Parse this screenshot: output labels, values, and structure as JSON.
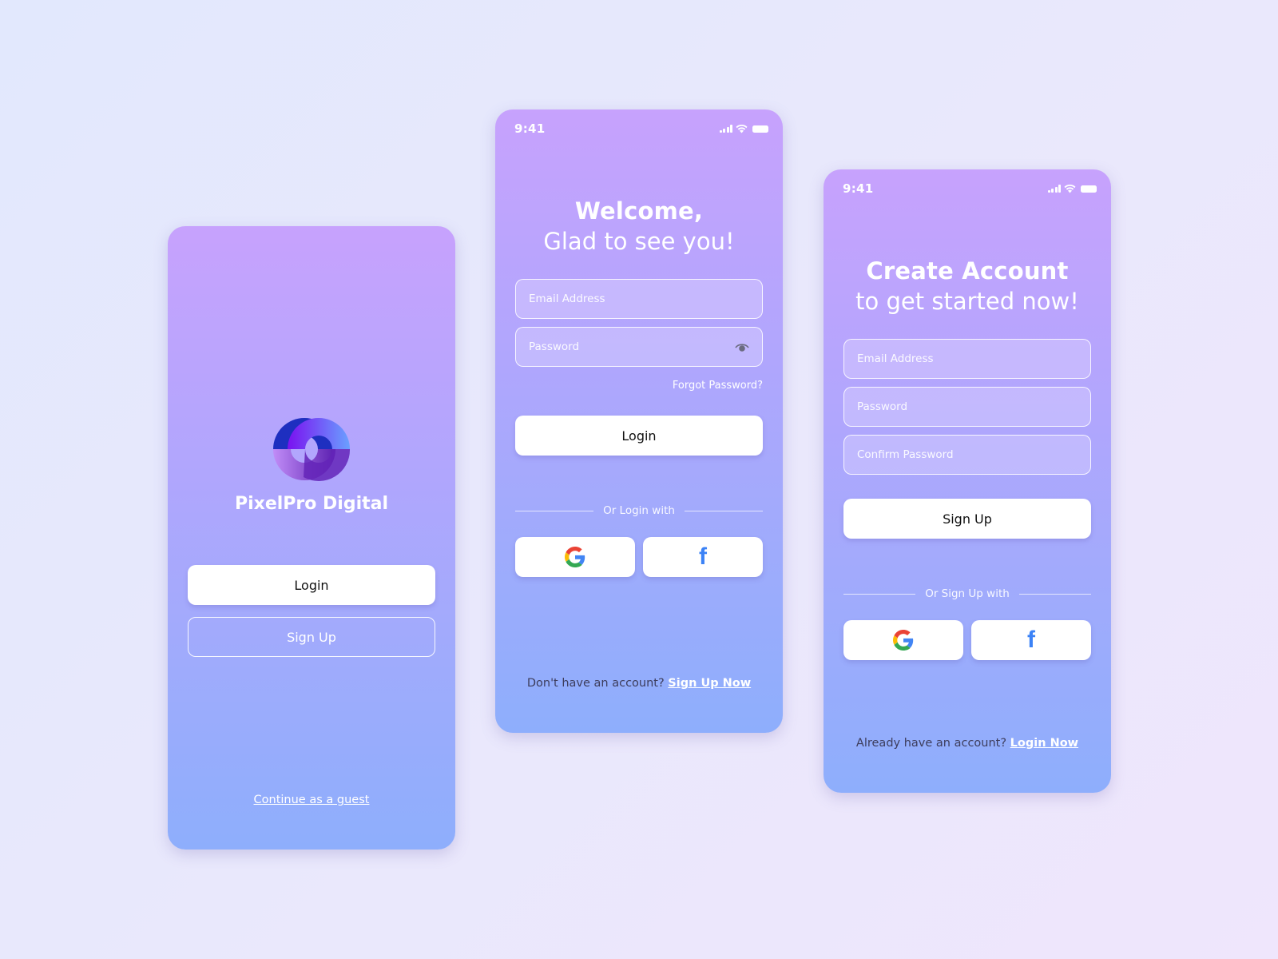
{
  "splash": {
    "brand_name": "PixelPro Digital",
    "login_label": "Login",
    "signup_label": "Sign Up",
    "guest_label": "Continue as a guest"
  },
  "login": {
    "status_time": "9:41",
    "title_bold": "Welcome,",
    "title_light": "Glad to see you!",
    "email_placeholder": "Email Address",
    "password_placeholder": "Password",
    "forgot_label": "Forgot Password?",
    "login_label": "Login",
    "divider_label": "Or Login with",
    "footer_prompt": "Don't have an account?",
    "footer_link": "Sign Up Now",
    "social": [
      "google-icon",
      "facebook-icon"
    ]
  },
  "signup": {
    "status_time": "9:41",
    "title_bold": "Create Account",
    "title_light": "to get started now!",
    "email_placeholder": "Email Address",
    "password_placeholder": "Password",
    "confirm_placeholder": "Confirm Password",
    "signup_label": "Sign Up",
    "divider_label": "Or Sign Up with",
    "footer_prompt": "Already have an account?",
    "footer_link": "Login Now",
    "social": [
      "google-icon",
      "facebook-icon"
    ]
  },
  "colors": {
    "gradient_top": "#c7a2fd",
    "gradient_bottom": "#8eaefc",
    "facebook_blue": "#3b82f6",
    "background": "#e6e8fc"
  }
}
